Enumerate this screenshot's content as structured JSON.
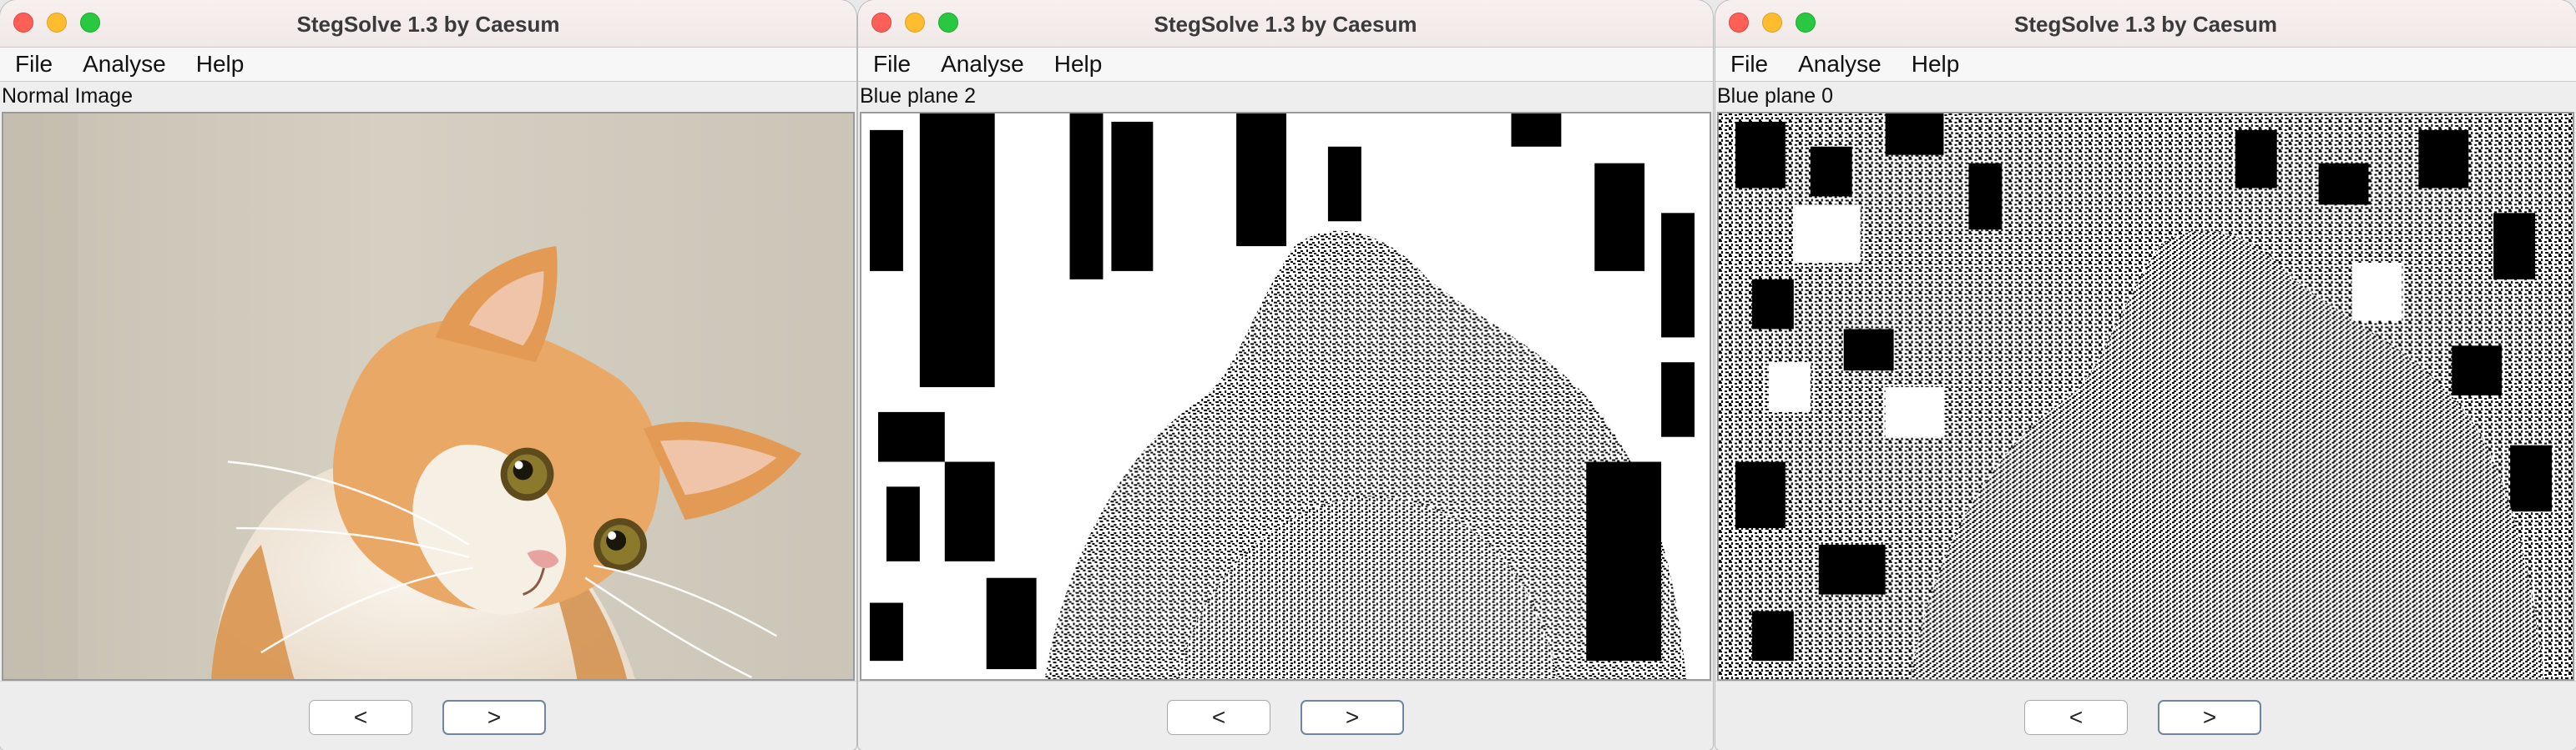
{
  "windows": [
    {
      "title": "StegSolve 1.3 by Caesum",
      "menu": [
        "File",
        "Analyse",
        "Help"
      ],
      "caption": "Normal Image",
      "view": "photo",
      "prev_label": "<",
      "next_label": ">"
    },
    {
      "title": "StegSolve 1.3 by Caesum",
      "menu": [
        "File",
        "Analyse",
        "Help"
      ],
      "caption": "Blue plane 2",
      "view": "bitplane",
      "prev_label": "<",
      "next_label": ">"
    },
    {
      "title": "StegSolve 1.3 by Caesum",
      "menu": [
        "File",
        "Analyse",
        "Help"
      ],
      "caption": "Blue plane 0",
      "view": "bitplane",
      "prev_label": "<",
      "next_label": ">"
    }
  ],
  "colors": {
    "close": "#fe5f57",
    "minimize": "#febc2e",
    "zoom": "#28c840",
    "photo_background": "#cfc8ba",
    "cat_white": "#f7f1e8",
    "cat_orange": "#dc9a56"
  }
}
